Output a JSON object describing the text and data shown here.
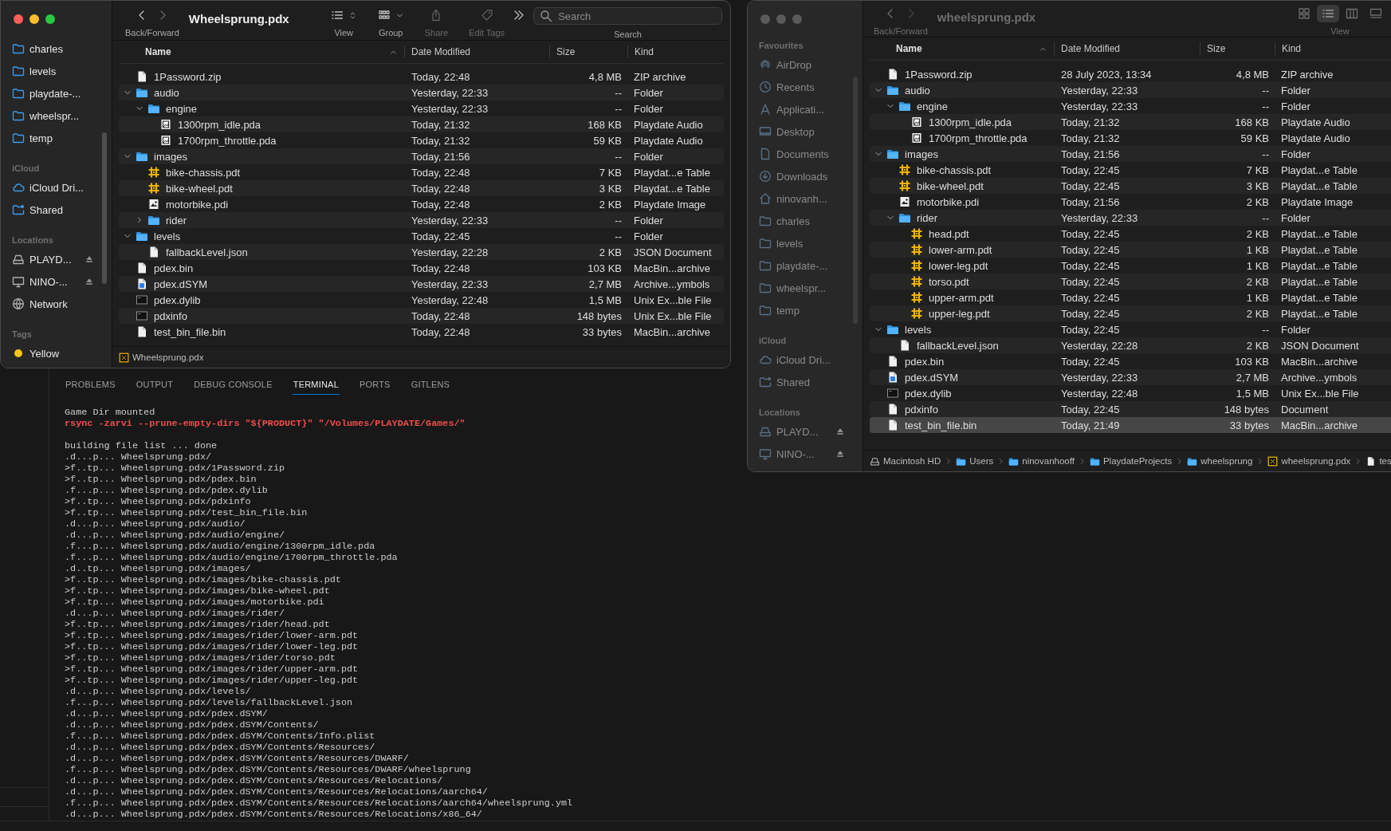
{
  "finders": [
    {
      "active": true,
      "title": "Wheelsprung.pdx",
      "toolbar": [
        {
          "kind": "nav",
          "label": "Back/Forward"
        },
        {
          "kind": "title"
        },
        {
          "kind": "view",
          "label": "View"
        },
        {
          "kind": "group",
          "label": "Group"
        },
        {
          "kind": "share",
          "label": "Share",
          "disabled": true
        },
        {
          "kind": "tags",
          "label": "Edit Tags",
          "disabled": true
        },
        {
          "kind": "more"
        },
        {
          "kind": "search",
          "label": "Search",
          "placeholder": "Search"
        }
      ],
      "sidebar": [
        {
          "items": [
            {
              "label": "charles",
              "kind": "folder",
              "eject": false
            },
            {
              "label": "levels",
              "kind": "folder",
              "eject": false
            },
            {
              "label": "playdate-...",
              "kind": "folder",
              "eject": false
            },
            {
              "label": "wheelspr...",
              "kind": "folder",
              "eject": false
            },
            {
              "label": "temp",
              "kind": "folder",
              "eject": false
            }
          ]
        },
        {
          "heading": "iCloud",
          "items": [
            {
              "label": "iCloud Dri...",
              "kind": "cloud",
              "eject": false
            },
            {
              "label": "Shared",
              "kind": "shared",
              "eject": false
            }
          ]
        },
        {
          "heading": "Locations",
          "items": [
            {
              "label": "PLAYD...",
              "kind": "drive",
              "eject": true
            },
            {
              "label": "NINO-...",
              "kind": "display",
              "eject": true
            },
            {
              "label": "Network",
              "kind": "network",
              "eject": false
            }
          ]
        },
        {
          "heading": "Tags",
          "items": [
            {
              "label": "Yellow",
              "kind": "tag",
              "color": "#f5c518",
              "eject": false
            }
          ]
        }
      ],
      "columns": [
        {
          "label": "Name",
          "sorted": true
        },
        {
          "label": "Date Modified",
          "sorted": false
        },
        {
          "label": "Size",
          "sorted": false
        },
        {
          "label": "Kind",
          "sorted": false
        }
      ],
      "rows": [
        {
          "name": "1Password.zip",
          "kind": "file",
          "date": "Today, 22:48",
          "size": "4,8 MB",
          "file_kind": "ZIP archive",
          "selected": false
        },
        {
          "name": "audio",
          "kind": "folder",
          "date": "Yesterday, 22:33",
          "size": "--",
          "file_kind": "Folder",
          "selected": false,
          "expanded": true,
          "children": [
            {
              "name": "engine",
              "kind": "folder",
              "date": "Yesterday, 22:33",
              "size": "--",
              "file_kind": "Folder",
              "selected": false,
              "expanded": true,
              "children": [
                {
                  "name": "1300rpm_idle.pda",
                  "kind": "audio",
                  "date": "Today, 21:32",
                  "size": "168 KB",
                  "file_kind": "Playdate Audio",
                  "selected": false
                },
                {
                  "name": "1700rpm_throttle.pda",
                  "kind": "audio",
                  "date": "Today, 21:32",
                  "size": "59 KB",
                  "file_kind": "Playdate Audio",
                  "selected": false
                }
              ]
            }
          ]
        },
        {
          "name": "images",
          "kind": "folder",
          "date": "Today, 21:56",
          "size": "--",
          "file_kind": "Folder",
          "selected": false,
          "expanded": true,
          "children": [
            {
              "name": "bike-chassis.pdt",
              "kind": "table",
              "date": "Today, 22:48",
              "size": "7 KB",
              "file_kind": "Playdat...e Table",
              "selected": false
            },
            {
              "name": "bike-wheel.pdt",
              "kind": "table",
              "date": "Today, 22:48",
              "size": "3 KB",
              "file_kind": "Playdat...e Table",
              "selected": false
            },
            {
              "name": "motorbike.pdi",
              "kind": "image",
              "date": "Today, 22:48",
              "size": "2 KB",
              "file_kind": "Playdate Image",
              "selected": false
            },
            {
              "name": "rider",
              "kind": "folder",
              "date": "Yesterday, 22:33",
              "size": "--",
              "file_kind": "Folder",
              "selected": false,
              "expanded": false
            }
          ]
        },
        {
          "name": "levels",
          "kind": "folder",
          "date": "Today, 22:45",
          "size": "--",
          "file_kind": "Folder",
          "selected": false,
          "expanded": true,
          "children": [
            {
              "name": "fallbackLevel.json",
              "kind": "file",
              "date": "Yesterday, 22:28",
              "size": "2 KB",
              "file_kind": "JSON Document",
              "selected": false
            }
          ]
        },
        {
          "name": "pdex.bin",
          "kind": "file",
          "date": "Today, 22:48",
          "size": "103 KB",
          "file_kind": "MacBin...archive",
          "selected": false
        },
        {
          "name": "pdex.dSYM",
          "kind": "dsym",
          "date": "Yesterday, 22:33",
          "size": "2,7 MB",
          "file_kind": "Archive...ymbols",
          "selected": false
        },
        {
          "name": "pdex.dylib",
          "kind": "exec",
          "date": "Yesterday, 22:48",
          "size": "1,5 MB",
          "file_kind": "Unix Ex...ble File",
          "selected": false
        },
        {
          "name": "pdxinfo",
          "kind": "exec",
          "date": "Today, 22:48",
          "size": "148 bytes",
          "file_kind": "Unix Ex...ble File",
          "selected": false
        },
        {
          "name": "test_bin_file.bin",
          "kind": "file",
          "date": "Today, 22:48",
          "size": "33 bytes",
          "file_kind": "MacBin...archive",
          "selected": false
        }
      ],
      "path_bar": [
        {
          "label": "Wheelsprung.pdx",
          "kind": "package"
        }
      ]
    },
    {
      "active": false,
      "title": "wheelsprung.pdx",
      "toolbar": [
        {
          "kind": "nav",
          "label": "Back/Forward"
        },
        {
          "kind": "title"
        },
        {
          "kind": "modes",
          "label": "View",
          "modes": [
            {
              "kind": "icons",
              "selected": false
            },
            {
              "kind": "list",
              "selected": true
            },
            {
              "kind": "columns",
              "selected": false
            },
            {
              "kind": "gallery",
              "selected": false
            }
          ]
        }
      ],
      "sidebar": [
        {
          "heading": "Favourites",
          "items": [
            {
              "label": "AirDrop",
              "kind": "airdrop",
              "eject": false
            },
            {
              "label": "Recents",
              "kind": "recents",
              "eject": false
            },
            {
              "label": "Applicati...",
              "kind": "apps",
              "eject": false
            },
            {
              "label": "Desktop",
              "kind": "desktop",
              "eject": false
            },
            {
              "label": "Documents",
              "kind": "document",
              "eject": false
            },
            {
              "label": "Downloads",
              "kind": "downloads",
              "eject": false
            },
            {
              "label": "ninovanh...",
              "kind": "home",
              "eject": false
            },
            {
              "label": "charles",
              "kind": "folder",
              "eject": false
            },
            {
              "label": "levels",
              "kind": "folder",
              "eject": false
            },
            {
              "label": "playdate-...",
              "kind": "folder",
              "eject": false
            },
            {
              "label": "wheelspr...",
              "kind": "folder",
              "eject": false
            },
            {
              "label": "temp",
              "kind": "folder",
              "eject": false
            }
          ]
        },
        {
          "heading": "iCloud",
          "items": [
            {
              "label": "iCloud Dri...",
              "kind": "cloud",
              "eject": false
            },
            {
              "label": "Shared",
              "kind": "shared",
              "eject": false
            }
          ]
        },
        {
          "heading": "Locations",
          "items": [
            {
              "label": "PLAYD...",
              "kind": "drive",
              "eject": true
            },
            {
              "label": "NINO-...",
              "kind": "display",
              "eject": true
            }
          ]
        }
      ],
      "columns": [
        {
          "label": "Name",
          "sorted": true
        },
        {
          "label": "Date Modified",
          "sorted": false
        },
        {
          "label": "Size",
          "sorted": false
        },
        {
          "label": "Kind",
          "sorted": false
        }
      ],
      "rows": [
        {
          "name": "1Password.zip",
          "kind": "file",
          "date": "28 July 2023, 13:34",
          "size": "4,8 MB",
          "file_kind": "ZIP archive",
          "selected": false
        },
        {
          "name": "audio",
          "kind": "folder",
          "date": "Yesterday, 22:33",
          "size": "--",
          "file_kind": "Folder",
          "selected": false,
          "expanded": true,
          "children": [
            {
              "name": "engine",
              "kind": "folder",
              "date": "Yesterday, 22:33",
              "size": "--",
              "file_kind": "Folder",
              "selected": false,
              "expanded": true,
              "children": [
                {
                  "name": "1300rpm_idle.pda",
                  "kind": "audio",
                  "date": "Today, 21:32",
                  "size": "168 KB",
                  "file_kind": "Playdate Audio",
                  "selected": false
                },
                {
                  "name": "1700rpm_throttle.pda",
                  "kind": "audio",
                  "date": "Today, 21:32",
                  "size": "59 KB",
                  "file_kind": "Playdate Audio",
                  "selected": false
                }
              ]
            }
          ]
        },
        {
          "name": "images",
          "kind": "folder",
          "date": "Today, 21:56",
          "size": "--",
          "file_kind": "Folder",
          "selected": false,
          "expanded": true,
          "children": [
            {
              "name": "bike-chassis.pdt",
              "kind": "table",
              "date": "Today, 22:45",
              "size": "7 KB",
              "file_kind": "Playdat...e Table",
              "selected": false
            },
            {
              "name": "bike-wheel.pdt",
              "kind": "table",
              "date": "Today, 22:45",
              "size": "3 KB",
              "file_kind": "Playdat...e Table",
              "selected": false
            },
            {
              "name": "motorbike.pdi",
              "kind": "image",
              "date": "Today, 21:56",
              "size": "2 KB",
              "file_kind": "Playdate Image",
              "selected": false
            },
            {
              "name": "rider",
              "kind": "folder",
              "date": "Yesterday, 22:33",
              "size": "--",
              "file_kind": "Folder",
              "selected": false,
              "expanded": true,
              "children": [
                {
                  "name": "head.pdt",
                  "kind": "table",
                  "date": "Today, 22:45",
                  "size": "2 KB",
                  "file_kind": "Playdat...e Table",
                  "selected": false
                },
                {
                  "name": "lower-arm.pdt",
                  "kind": "table",
                  "date": "Today, 22:45",
                  "size": "1 KB",
                  "file_kind": "Playdat...e Table",
                  "selected": false
                },
                {
                  "name": "lower-leg.pdt",
                  "kind": "table",
                  "date": "Today, 22:45",
                  "size": "1 KB",
                  "file_kind": "Playdat...e Table",
                  "selected": false
                },
                {
                  "name": "torso.pdt",
                  "kind": "table",
                  "date": "Today, 22:45",
                  "size": "2 KB",
                  "file_kind": "Playdat...e Table",
                  "selected": false
                },
                {
                  "name": "upper-arm.pdt",
                  "kind": "table",
                  "date": "Today, 22:45",
                  "size": "1 KB",
                  "file_kind": "Playdat...e Table",
                  "selected": false
                },
                {
                  "name": "upper-leg.pdt",
                  "kind": "table",
                  "date": "Today, 22:45",
                  "size": "2 KB",
                  "file_kind": "Playdat...e Table",
                  "selected": false
                }
              ]
            }
          ]
        },
        {
          "name": "levels",
          "kind": "folder",
          "date": "Today, 22:45",
          "size": "--",
          "file_kind": "Folder",
          "selected": false,
          "expanded": true,
          "children": [
            {
              "name": "fallbackLevel.json",
              "kind": "file",
              "date": "Yesterday, 22:28",
              "size": "2 KB",
              "file_kind": "JSON Document",
              "selected": false
            }
          ]
        },
        {
          "name": "pdex.bin",
          "kind": "file",
          "date": "Today, 22:45",
          "size": "103 KB",
          "file_kind": "MacBin...archive",
          "selected": false
        },
        {
          "name": "pdex.dSYM",
          "kind": "dsym",
          "date": "Yesterday, 22:33",
          "size": "2,7 MB",
          "file_kind": "Archive...ymbols",
          "selected": false
        },
        {
          "name": "pdex.dylib",
          "kind": "exec",
          "date": "Yesterday, 22:48",
          "size": "1,5 MB",
          "file_kind": "Unix Ex...ble File",
          "selected": false
        },
        {
          "name": "pdxinfo",
          "kind": "file",
          "date": "Today, 22:45",
          "size": "148 bytes",
          "file_kind": "Document",
          "selected": false
        },
        {
          "name": "test_bin_file.bin",
          "kind": "file",
          "date": "Today, 21:49",
          "size": "33 bytes",
          "file_kind": "MacBin...archive",
          "selected": true
        }
      ],
      "path_bar": [
        {
          "label": "Macintosh HD",
          "kind": "drive"
        },
        {
          "label": "Users",
          "kind": "folder"
        },
        {
          "label": "ninovanhooff",
          "kind": "folder"
        },
        {
          "label": "PlaydateProjects",
          "kind": "folder"
        },
        {
          "label": "wheelsprung",
          "kind": "folder"
        },
        {
          "label": "wheelsprung.pdx",
          "kind": "package"
        },
        {
          "label": "tes",
          "kind": "file"
        }
      ]
    }
  ],
  "panel": {
    "tabs": [
      {
        "label": "PROBLEMS",
        "selected": false
      },
      {
        "label": "OUTPUT",
        "selected": false
      },
      {
        "label": "DEBUG CONSOLE",
        "selected": false
      },
      {
        "label": "TERMINAL",
        "selected": true
      },
      {
        "label": "PORTS",
        "selected": false
      },
      {
        "label": "GITLENS",
        "selected": false
      }
    ],
    "terminal_blocks": [
      [
        {
          "text": "Game Dir mounted",
          "kind": "output"
        },
        {
          "text": "rsync -zarvi --prune-empty-dirs \"${PRODUCT}\" \"/Volumes/PLAYDATE/Games/\"",
          "kind": "command"
        }
      ],
      [
        {
          "text": "building file list ... done",
          "kind": "output"
        },
        {
          "text": ".d...p... Wheelsprung.pdx/",
          "kind": "output"
        },
        {
          "text": ">f..tp... Wheelsprung.pdx/1Password.zip",
          "kind": "output"
        },
        {
          "text": ">f..tp... Wheelsprung.pdx/pdex.bin",
          "kind": "output"
        },
        {
          "text": ".f...p... Wheelsprung.pdx/pdex.dylib",
          "kind": "output"
        },
        {
          "text": ">f..tp... Wheelsprung.pdx/pdxinfo",
          "kind": "output"
        },
        {
          "text": ">f..tp... Wheelsprung.pdx/test_bin_file.bin",
          "kind": "output"
        },
        {
          "text": ".d...p... Wheelsprung.pdx/audio/",
          "kind": "output"
        },
        {
          "text": ".d...p... Wheelsprung.pdx/audio/engine/",
          "kind": "output"
        },
        {
          "text": ".f...p... Wheelsprung.pdx/audio/engine/1300rpm_idle.pda",
          "kind": "output"
        },
        {
          "text": ".f...p... Wheelsprung.pdx/audio/engine/1700rpm_throttle.pda",
          "kind": "output"
        },
        {
          "text": ".d..tp... Wheelsprung.pdx/images/",
          "kind": "output"
        },
        {
          "text": ">f..tp... Wheelsprung.pdx/images/bike-chassis.pdt",
          "kind": "output"
        },
        {
          "text": ">f..tp... Wheelsprung.pdx/images/bike-wheel.pdt",
          "kind": "output"
        },
        {
          "text": ">f..tp... Wheelsprung.pdx/images/motorbike.pdi",
          "kind": "output"
        },
        {
          "text": ".d...p... Wheelsprung.pdx/images/rider/",
          "kind": "output"
        },
        {
          "text": ">f..tp... Wheelsprung.pdx/images/rider/head.pdt",
          "kind": "output"
        },
        {
          "text": ">f..tp... Wheelsprung.pdx/images/rider/lower-arm.pdt",
          "kind": "output"
        },
        {
          "text": ">f..tp... Wheelsprung.pdx/images/rider/lower-leg.pdt",
          "kind": "output"
        },
        {
          "text": ">f..tp... Wheelsprung.pdx/images/rider/torso.pdt",
          "kind": "output"
        },
        {
          "text": ">f..tp... Wheelsprung.pdx/images/rider/upper-arm.pdt",
          "kind": "output"
        },
        {
          "text": ">f..tp... Wheelsprung.pdx/images/rider/upper-leg.pdt",
          "kind": "output"
        },
        {
          "text": ".d...p... Wheelsprung.pdx/levels/",
          "kind": "output"
        },
        {
          "text": ".f...p... Wheelsprung.pdx/levels/fallbackLevel.json",
          "kind": "output"
        },
        {
          "text": ".d...p... Wheelsprung.pdx/pdex.dSYM/",
          "kind": "output"
        },
        {
          "text": ".d...p... Wheelsprung.pdx/pdex.dSYM/Contents/",
          "kind": "output"
        },
        {
          "text": ".f...p... Wheelsprung.pdx/pdex.dSYM/Contents/Info.plist",
          "kind": "output"
        },
        {
          "text": ".d...p... Wheelsprung.pdx/pdex.dSYM/Contents/Resources/",
          "kind": "output"
        },
        {
          "text": ".d...p... Wheelsprung.pdx/pdex.dSYM/Contents/Resources/DWARF/",
          "kind": "output"
        },
        {
          "text": ".f...p... Wheelsprung.pdx/pdex.dSYM/Contents/Resources/DWARF/wheelsprung",
          "kind": "output"
        },
        {
          "text": ".d...p... Wheelsprung.pdx/pdex.dSYM/Contents/Resources/Relocations/",
          "kind": "output"
        },
        {
          "text": ".d...p... Wheelsprung.pdx/pdex.dSYM/Contents/Resources/Relocations/aarch64/",
          "kind": "output"
        },
        {
          "text": ".f...p... Wheelsprung.pdx/pdex.dSYM/Contents/Resources/Relocations/aarch64/wheelsprung.yml",
          "kind": "output"
        },
        {
          "text": ".d...p... Wheelsprung.pdx/pdex.dSYM/Contents/Resources/Relocations/x86_64/",
          "kind": "output"
        }
      ]
    ]
  }
}
